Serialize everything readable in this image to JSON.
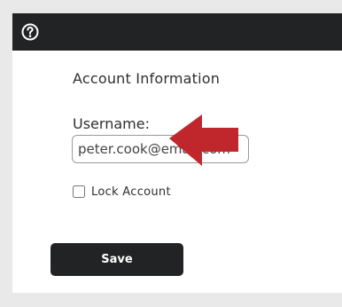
{
  "header": {
    "help_icon": "question-circle-icon"
  },
  "form": {
    "title": "Account Information",
    "username_label": "Username:",
    "username_value": "peter.cook@email.com",
    "lock_account_label": "Lock Account",
    "lock_account_checked": false,
    "save_label": "Save"
  },
  "annotation": {
    "icon": "red-arrow-left-icon",
    "color": "#c0272d"
  },
  "colors": {
    "header_bar": "#222324",
    "save_button": "#222324",
    "background": "#e9e9e9"
  }
}
